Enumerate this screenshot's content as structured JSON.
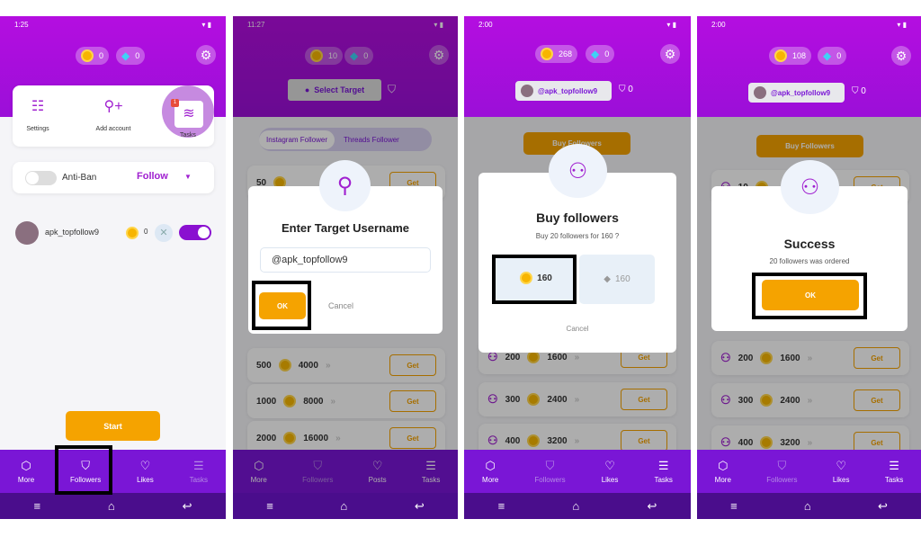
{
  "colors": {
    "purple": "#9b0fd8",
    "nav": "#7a16d6",
    "orange": "#f5a300",
    "highlight": "#000000"
  },
  "screens": [
    {
      "status_time": "1:25",
      "coins": "0",
      "diamonds": "0",
      "quick": [
        {
          "label": "Settings",
          "icon": "sliders-icon"
        },
        {
          "label": "Add account",
          "icon": "add-user-icon"
        },
        {
          "label": "Tasks",
          "icon": "coins-icon",
          "badge": "1"
        }
      ],
      "antiban": "Anti-Ban",
      "mode": "Follow",
      "account": {
        "name": "apk_topfollow9",
        "coins": "0"
      },
      "start": "Start",
      "nav": [
        "More",
        "Followers",
        "Likes",
        "Tasks"
      ]
    },
    {
      "status_time": "11:27",
      "coins": "10",
      "diamonds": "0",
      "select_target": "Select Target",
      "tabs": [
        "Instagram Follower",
        "Threads Follower"
      ],
      "rows": [
        {
          "count": "50",
          "price": ""
        },
        {
          "count": "500",
          "price": "4000"
        },
        {
          "count": "1000",
          "price": "8000"
        },
        {
          "count": "2000",
          "price": "16000"
        }
      ],
      "get": "Get",
      "dialog": {
        "title": "Enter Target Username",
        "input": "@apk_topfollow9",
        "ok": "OK",
        "cancel": "Cancel"
      },
      "nav": [
        "More",
        "Followers",
        "Posts",
        "Tasks"
      ]
    },
    {
      "status_time": "2:00",
      "coins": "268",
      "diamonds": "0",
      "account": "@apk_topfollow9",
      "followers": "0",
      "buy": "Buy Followers",
      "rows": [
        {
          "count": "200",
          "price": "1600"
        },
        {
          "count": "300",
          "price": "2400"
        },
        {
          "count": "400",
          "price": "3200"
        }
      ],
      "get": "Get",
      "dialog": {
        "title": "Buy followers",
        "subtitle": "Buy 20 followers for 160 ?",
        "coin_price": "160",
        "diamond_price": "160",
        "cancel": "Cancel"
      },
      "nav": [
        "More",
        "Followers",
        "Likes",
        "Tasks"
      ]
    },
    {
      "status_time": "2:00",
      "coins": "108",
      "diamonds": "0",
      "account": "@apk_topfollow9",
      "followers": "0",
      "buy": "Buy Followers",
      "rows": [
        {
          "count": "10",
          "price": ""
        },
        {
          "count": "200",
          "price": "1600"
        },
        {
          "count": "300",
          "price": "2400"
        },
        {
          "count": "400",
          "price": "3200"
        }
      ],
      "get": "Get",
      "dialog": {
        "title": "Success",
        "subtitle": "20 followers was ordered",
        "ok": "OK"
      },
      "nav": [
        "More",
        "Followers",
        "Likes",
        "Tasks"
      ]
    }
  ]
}
